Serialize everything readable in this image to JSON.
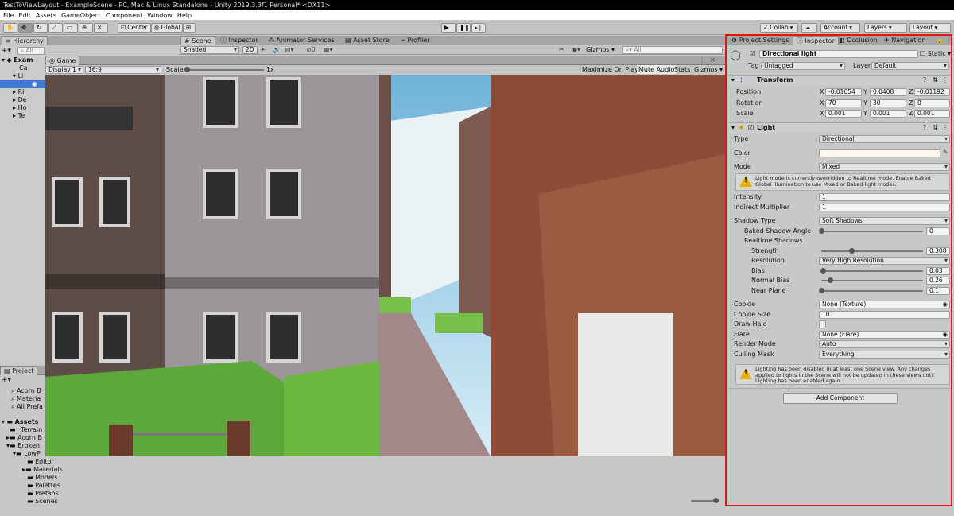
{
  "window": {
    "title": "TestToViewLayout - ExampleScene - PC, Mac & Linux Standalone - Unity 2019.3.3f1 Personal* <DX11>"
  },
  "menu": [
    "File",
    "Edit",
    "Assets",
    "GameObject",
    "Component",
    "Window",
    "Help"
  ],
  "toolbar": {
    "center_label": "Center",
    "global_label": "Global",
    "collab_label": "Collab",
    "account_label": "Account",
    "layers_label": "Layers",
    "layout_label": "Layout"
  },
  "hierarchy": {
    "tab": "Hierarchy",
    "search_placeholder": "All",
    "items": [
      "Exam",
      "Ca",
      "Li",
      "",
      "Ri",
      "De",
      "Ho",
      "Te"
    ]
  },
  "scene_tabs": [
    "Scene",
    "Inspector",
    "Animator",
    "Services",
    "Asset Store",
    "Profiler"
  ],
  "scene_toolbar": {
    "shading": "Shaded",
    "mode2d": "2D",
    "fx_count": "0",
    "gizmos": "Gizmos",
    "search_placeholder": "All"
  },
  "game": {
    "tab": "Game",
    "display": "Display 1",
    "aspect": "16:9",
    "scale_label": "Scale",
    "scale_value": "1x",
    "maximize": "Maximize On Play",
    "mute": "Mute Audio",
    "stats": "Stats",
    "gizmos": "Gizmos"
  },
  "project": {
    "tab": "Project",
    "favorites": [
      "Acorn B",
      "Materia",
      "All Prefa"
    ],
    "assets_label": "Assets",
    "tree": [
      "_Terrain",
      "Acorn B",
      "Broken",
      "LowP",
      "Editor",
      "Materials",
      "Models",
      "Palettes",
      "Prefabs",
      "Scenes"
    ]
  },
  "inspector_tabs": [
    "Project Settings",
    "Inspector",
    "Occlusion",
    "Navigation"
  ],
  "inspector": {
    "object_name": "Directional light",
    "static_label": "Static",
    "tag_label": "Tag",
    "tag_value": "Untagged",
    "layer_label": "Layer",
    "layer_value": "Default",
    "transform": {
      "title": "Transform",
      "position_label": "Position",
      "rotation_label": "Rotation",
      "scale_label": "Scale",
      "position": {
        "x": "-0.01654",
        "y": "0.0408",
        "z": "-0.01192"
      },
      "rotation": {
        "x": "70",
        "y": "30",
        "z": "0"
      },
      "scale": {
        "x": "0.001",
        "y": "0.001",
        "z": "0.001"
      }
    },
    "light": {
      "title": "Light",
      "type_label": "Type",
      "type_value": "Directional",
      "color_label": "Color",
      "mode_label": "Mode",
      "mode_value": "Mixed",
      "mode_warning": "Light mode is currently overridden to Realtime mode. Enable Baked Global Illumination to use Mixed or Baked light modes.",
      "intensity_label": "Intensity",
      "intensity_value": "1",
      "indirect_label": "Indirect Multiplier",
      "indirect_value": "1",
      "shadow_type_label": "Shadow Type",
      "shadow_type_value": "Soft Shadows",
      "baked_angle_label": "Baked Shadow Angle",
      "baked_angle_value": "0",
      "realtime_label": "Realtime Shadows",
      "strength_label": "Strength",
      "strength_value": "0.308",
      "resolution_label": "Resolution",
      "resolution_value": "Very High Resolution",
      "bias_label": "Bias",
      "bias_value": "0.03",
      "normal_bias_label": "Normal Bias",
      "normal_bias_value": "0.26",
      "near_plane_label": "Near Plane",
      "near_plane_value": "0.1",
      "cookie_label": "Cookie",
      "cookie_value": "None (Texture)",
      "cookie_size_label": "Cookie Size",
      "cookie_size_value": "10",
      "draw_halo_label": "Draw Halo",
      "flare_label": "Flare",
      "flare_value": "None (Flare)",
      "render_mode_label": "Render Mode",
      "render_mode_value": "Auto",
      "culling_label": "Culling Mask",
      "culling_value": "Everything",
      "lighting_warning": "Lighting has been disabled in at least one Scene view. Any changes applied to lights in the Scene will not be updated in these views until Lighting has been enabled again."
    },
    "add_component": "Add Component"
  },
  "colors": {
    "highlight": "#e0141c",
    "selection": "#3d7ad6",
    "warning": "#e8b000"
  }
}
